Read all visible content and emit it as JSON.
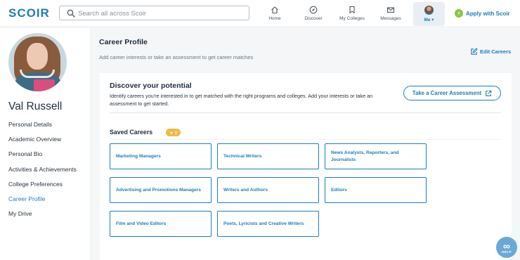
{
  "app": {
    "logo": "SCOIR"
  },
  "search": {
    "placeholder": "Search all across Scoir",
    "value": ""
  },
  "nav": {
    "home": {
      "label": "Home",
      "icon": "home-icon"
    },
    "discover": {
      "label": "Discover",
      "icon": "compass-icon"
    },
    "colleges": {
      "label": "My Colleges",
      "icon": "bookmark-icon"
    },
    "messages": {
      "label": "Messages",
      "icon": "mail-icon"
    },
    "me": {
      "label": "Me ▾",
      "icon": "avatar"
    },
    "apply": {
      "label": "Apply with Scoir",
      "icon": "lightning-icon"
    }
  },
  "profile": {
    "name": "Val Russell"
  },
  "sidebar": {
    "items": [
      {
        "label": "Personal Details",
        "active": false
      },
      {
        "label": "Academic Overview",
        "active": false
      },
      {
        "label": "Personal Bio",
        "active": false
      },
      {
        "label": "Activities & Achievements",
        "active": false
      },
      {
        "label": "College Preferences",
        "active": false
      },
      {
        "label": "Career Profile",
        "active": true
      },
      {
        "label": "My Drive",
        "active": false
      }
    ]
  },
  "main": {
    "title": "Career Profile",
    "subtitle": "Add career interests or take an assessment to get career matches",
    "edit_label": "Edit Careers",
    "discover": {
      "title": "Discover your potential",
      "text": "Identify careers you're interested in to get matched with the right programs and colleges. Add your interests or take an assessment to get started.",
      "button": "Take a Career Assessment"
    },
    "saved": {
      "title": "Saved Careers",
      "count": "★ 8",
      "careers": [
        "Marketing Managers",
        "Technical Writers",
        "News Analysts, Reporters, and Journalists",
        "Advertising and Promotions Managers",
        "Writers and Authors",
        "Editors",
        "Film and Video Editors",
        "Poets, Lyricists and Creative Writers"
      ]
    }
  },
  "help": {
    "label": "HELP"
  },
  "colors": {
    "accent": "#1a7fb8",
    "badge": "#f4b942",
    "apply_dot": "#8cc63f",
    "background": "#f4f6f8"
  }
}
